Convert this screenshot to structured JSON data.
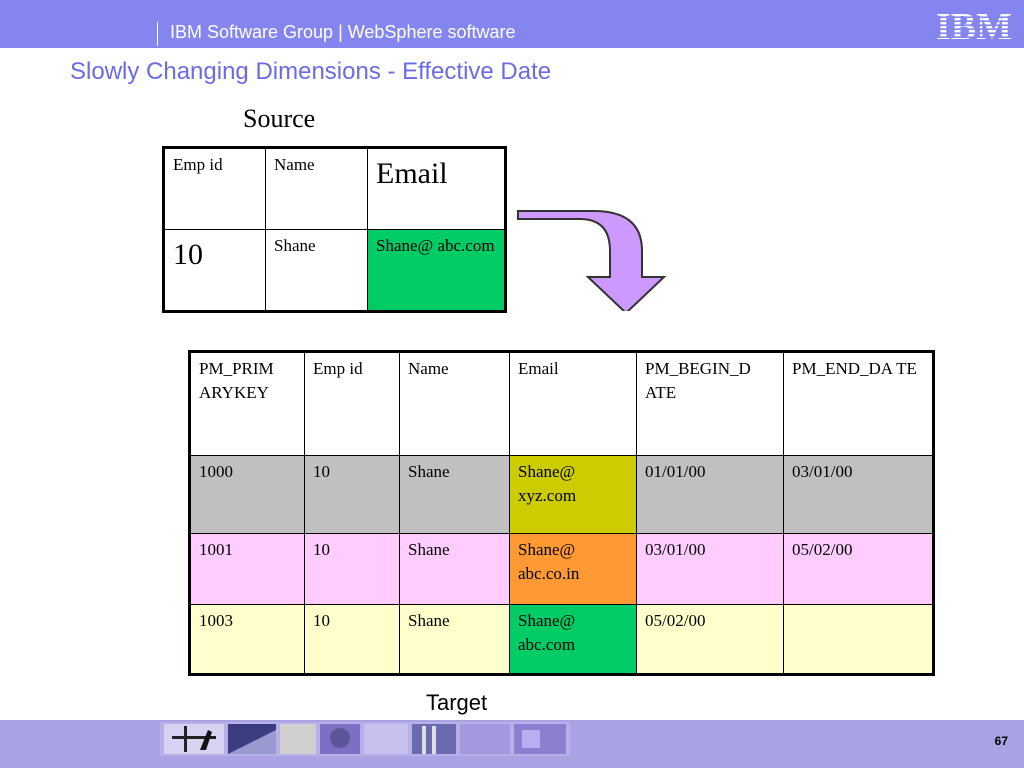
{
  "header": {
    "title": "IBM Software Group | WebSphere software",
    "logo_text": "IBM"
  },
  "slide": {
    "title": "Slowly Changing Dimensions - Effective Date",
    "source_label": "Source",
    "target_label": "Target",
    "page_number": "67"
  },
  "source_table": {
    "headers": [
      "Emp id",
      "Name",
      "Email"
    ],
    "row": [
      "10",
      "Shane",
      "Shane@ abc.com"
    ]
  },
  "target_table": {
    "headers": [
      "PM_PRIM ARYKEY",
      "Emp id",
      "Name",
      "Email",
      "PM_BEGIN_D ATE",
      "PM_END_DA TE"
    ],
    "rows": [
      [
        "1000",
        "10",
        "Shane",
        "Shane@ xyz.com",
        "01/01/00",
        "03/01/00"
      ],
      [
        "1001",
        "10",
        "Shane",
        "Shane@ abc.co.in",
        "03/01/00",
        "05/02/00"
      ],
      [
        "1003",
        "10",
        "Shane",
        "Shane@ abc.com",
        "05/02/00",
        ""
      ]
    ]
  },
  "colors": {
    "header_bg": "#8585f0",
    "title": "#6b6be6",
    "row_gray": "#c0c0c0",
    "row_pink": "#ffccff",
    "row_yellow": "#ffffcc",
    "email_olive": "#cccc00",
    "email_orange": "#ff9933",
    "email_green": "#00cc66",
    "arrow": "#cc99ff"
  }
}
